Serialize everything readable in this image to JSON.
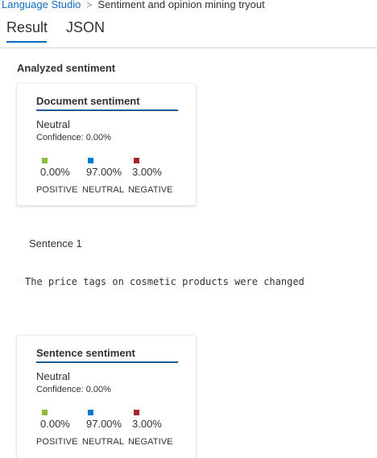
{
  "breadcrumb": {
    "root": "Language Studio",
    "separator": ">",
    "current": "Sentiment and opinion mining tryout"
  },
  "tabs": [
    {
      "label": "Result",
      "selected": true
    },
    {
      "label": "JSON",
      "selected": false
    }
  ],
  "section_title": "Analyzed sentiment",
  "document_card": {
    "title": "Document sentiment",
    "label": "Neutral",
    "confidence": "Confidence: 0.00%",
    "metrics": [
      {
        "value": "0.00%",
        "caption": "POSITIVE",
        "color": "#8cbd3f"
      },
      {
        "value": "97.00%",
        "caption": "NEUTRAL",
        "color": "#0078d4"
      },
      {
        "value": "3.00%",
        "caption": "NEGATIVE",
        "color": "#a4262c"
      }
    ]
  },
  "sentence": {
    "heading": "Sentence 1",
    "text": "The price tags on cosmetic products were changed"
  },
  "sentence_card": {
    "title": "Sentence sentiment",
    "label": "Neutral",
    "confidence": "Confidence: 0.00%",
    "metrics": [
      {
        "value": "0.00%",
        "caption": "POSITIVE",
        "color": "#8cbd3f"
      },
      {
        "value": "97.00%",
        "caption": "NEUTRAL",
        "color": "#0078d4"
      },
      {
        "value": "3.00%",
        "caption": "NEGATIVE",
        "color": "#a4262c"
      }
    ]
  },
  "colors": {
    "accent": "#0f6cbd",
    "card_title_underline": "#1a5a96"
  }
}
